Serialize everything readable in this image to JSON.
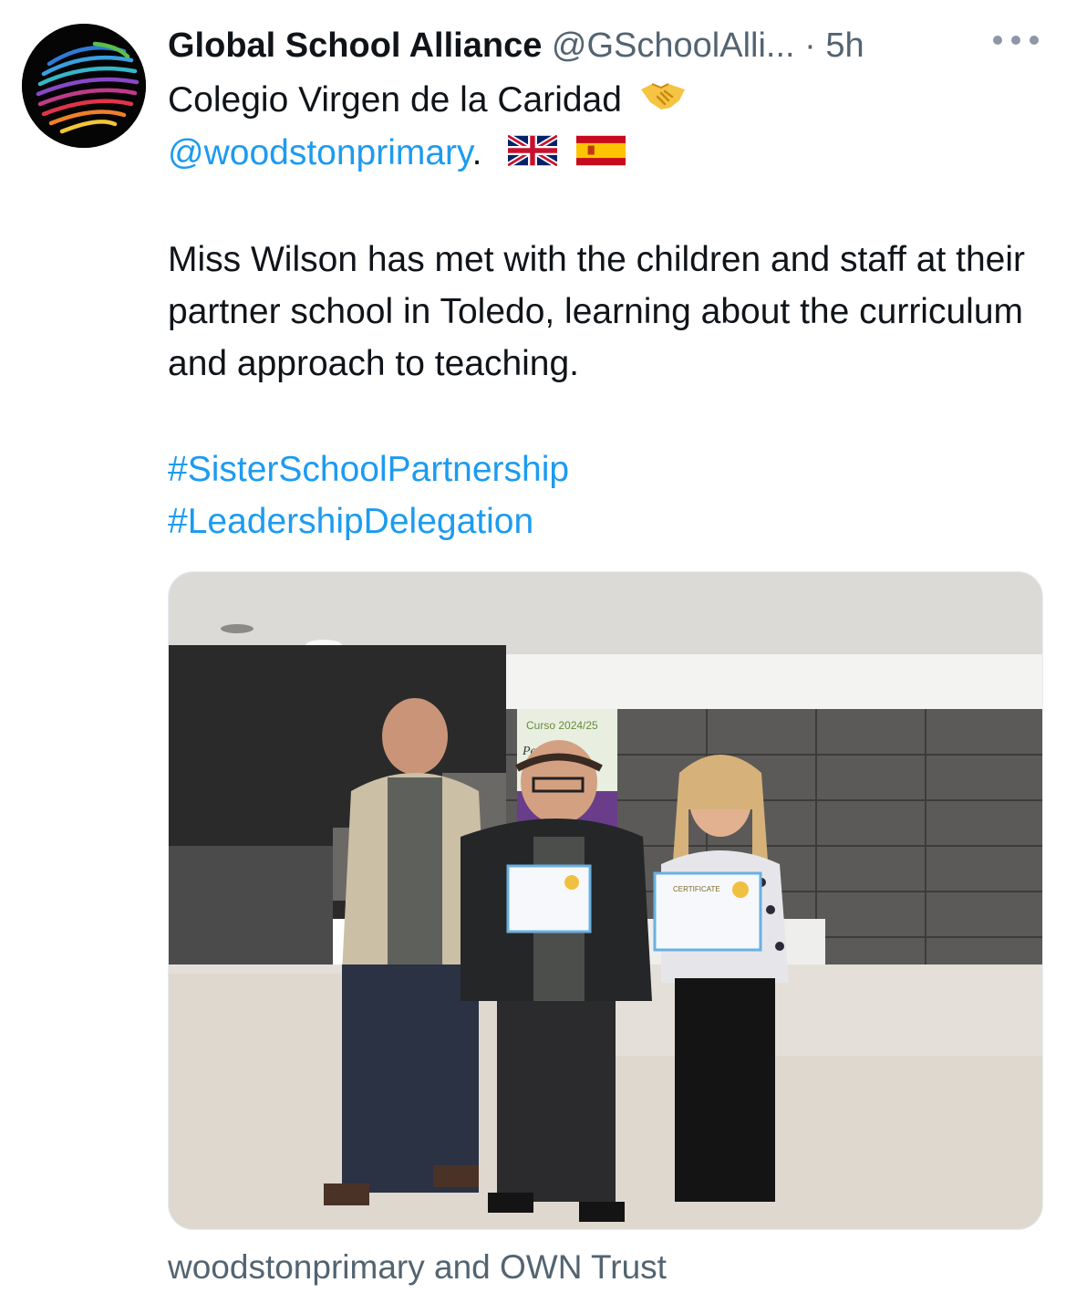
{
  "tweet": {
    "display_name": "Global School Alliance",
    "handle": "@GSchoolAlli...",
    "separator": "·",
    "time": "5h",
    "more_icon": "more-horizontal-icon",
    "line1": "Colegio Virgen de la Caridad",
    "line1_emoji": "handshake-emoji",
    "mention": "@woodstonprimary",
    "mention_suffix": ".",
    "flags": [
      "uk-flag",
      "spain-flag"
    ],
    "paragraph": "Miss Wilson has met with the children and staff at their partner school in Toledo, learning about the curriculum and approach to teaching.",
    "hashtags": [
      "#SisterSchoolPartnership",
      "#LeadershipDelegation"
    ],
    "photo": {
      "banner_text": "Curso 2024/25",
      "banner_subtext": "Per     s de",
      "certificate_label": "CERTIFICATE"
    },
    "tagged_users": "woodstonprimary and OWN Trust"
  },
  "colors": {
    "link": "#1d9bf0",
    "secondary_text": "#536471",
    "primary_text": "#0f1419"
  }
}
